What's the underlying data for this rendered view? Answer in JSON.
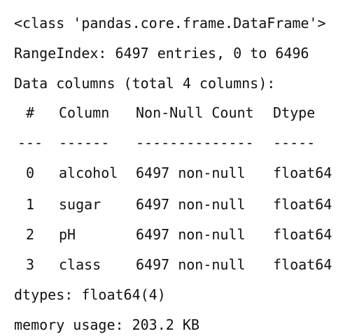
{
  "header": {
    "class_line": "<class 'pandas.core.frame.DataFrame'>",
    "range_line": "RangeIndex: 6497 entries, 0 to 6496",
    "data_columns_line": "Data columns (total 4 columns):"
  },
  "table": {
    "headers": {
      "index": "#",
      "column": "Column",
      "count": "Non-Null Count",
      "dtype": "Dtype"
    },
    "separators": {
      "index": "---",
      "column": "------",
      "count": "--------------",
      "dtype": "-----"
    },
    "rows": [
      {
        "index": "0",
        "column": "alcohol",
        "count": "6497 non-null",
        "dtype": "float64"
      },
      {
        "index": "1",
        "column": "sugar",
        "count": "6497 non-null",
        "dtype": "float64"
      },
      {
        "index": "2",
        "column": "pH",
        "count": "6497 non-null",
        "dtype": "float64"
      },
      {
        "index": "3",
        "column": "class",
        "count": "6497 non-null",
        "dtype": "float64"
      }
    ]
  },
  "footer": {
    "dtypes_line": "dtypes: float64(4)",
    "memory_line": "memory usage: 203.2 KB"
  }
}
